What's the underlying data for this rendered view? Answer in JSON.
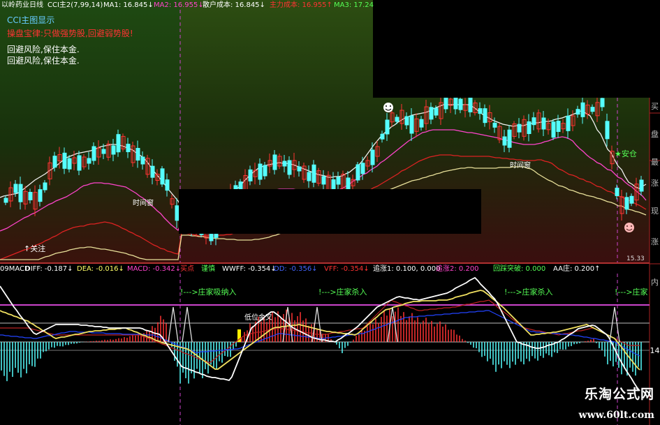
{
  "header": {
    "title": "以岭药业日线",
    "cci": "CCI主2(7,99,14)",
    "ma1": "MA1: 16.845↓",
    "ma2": "MA2: 16.955↓",
    "cost": "散户成本: 16.845↓",
    "main_cost": "主力成本: 16.955↑",
    "ma3": "MA3: 17.24"
  },
  "main_notes": {
    "title": "CCI主图显示",
    "rule": "操盘宝律:只做强势股,回避弱势股!",
    "line1": "回避风险,保住本金.",
    "line2": "回避风险,保住本金."
  },
  "chart_labels": {
    "time_window_1": "时间窗",
    "time_window_2": "时间窗",
    "watch": "↑关注",
    "safe": "★安仓",
    "low_price": "15.33"
  },
  "right_axis": [
    "买",
    "盘",
    "最",
    "涨",
    "现",
    "涨",
    "内"
  ],
  "right_axis_value": "14",
  "indicator_header": {
    "name": "09MACD",
    "diff": "DIFF: -0.187↓",
    "dea": "DEA: -0.016↓",
    "macd": "MACD: -0.342↓",
    "buy": "买点",
    "caution": "谨慎",
    "wwff": "WWFF: -0.354↓",
    "dd": "DD: -0.356↓",
    "vff": "VFF: -0.354↓",
    "chase1": "追涨1: 0.100, 0.000",
    "chase2": "追涨2: 0.200",
    "breakout": "回踩突破: 0.000",
    "aa": "AA庄: 0.200↑"
  },
  "indicator_labels": {
    "sig1": "!--->庄家吸纳入",
    "sig2": "!--->庄家杀入",
    "sig3": "!--->庄家杀入",
    "sig4": "!--->庄家",
    "golden": "低位金叉"
  },
  "watermark": {
    "title": "乐淘公式网",
    "url": "www.60lt.com"
  },
  "colors": {
    "up": "#ff3333",
    "down": "#55ffff",
    "ma_white": "#f0f0f0",
    "ma_pink": "#ff44cc",
    "ma_red": "#dd2222",
    "ma_yellow": "#e8e09a",
    "divider": "#cc44cc",
    "signal_green": "#55ff55"
  }
}
